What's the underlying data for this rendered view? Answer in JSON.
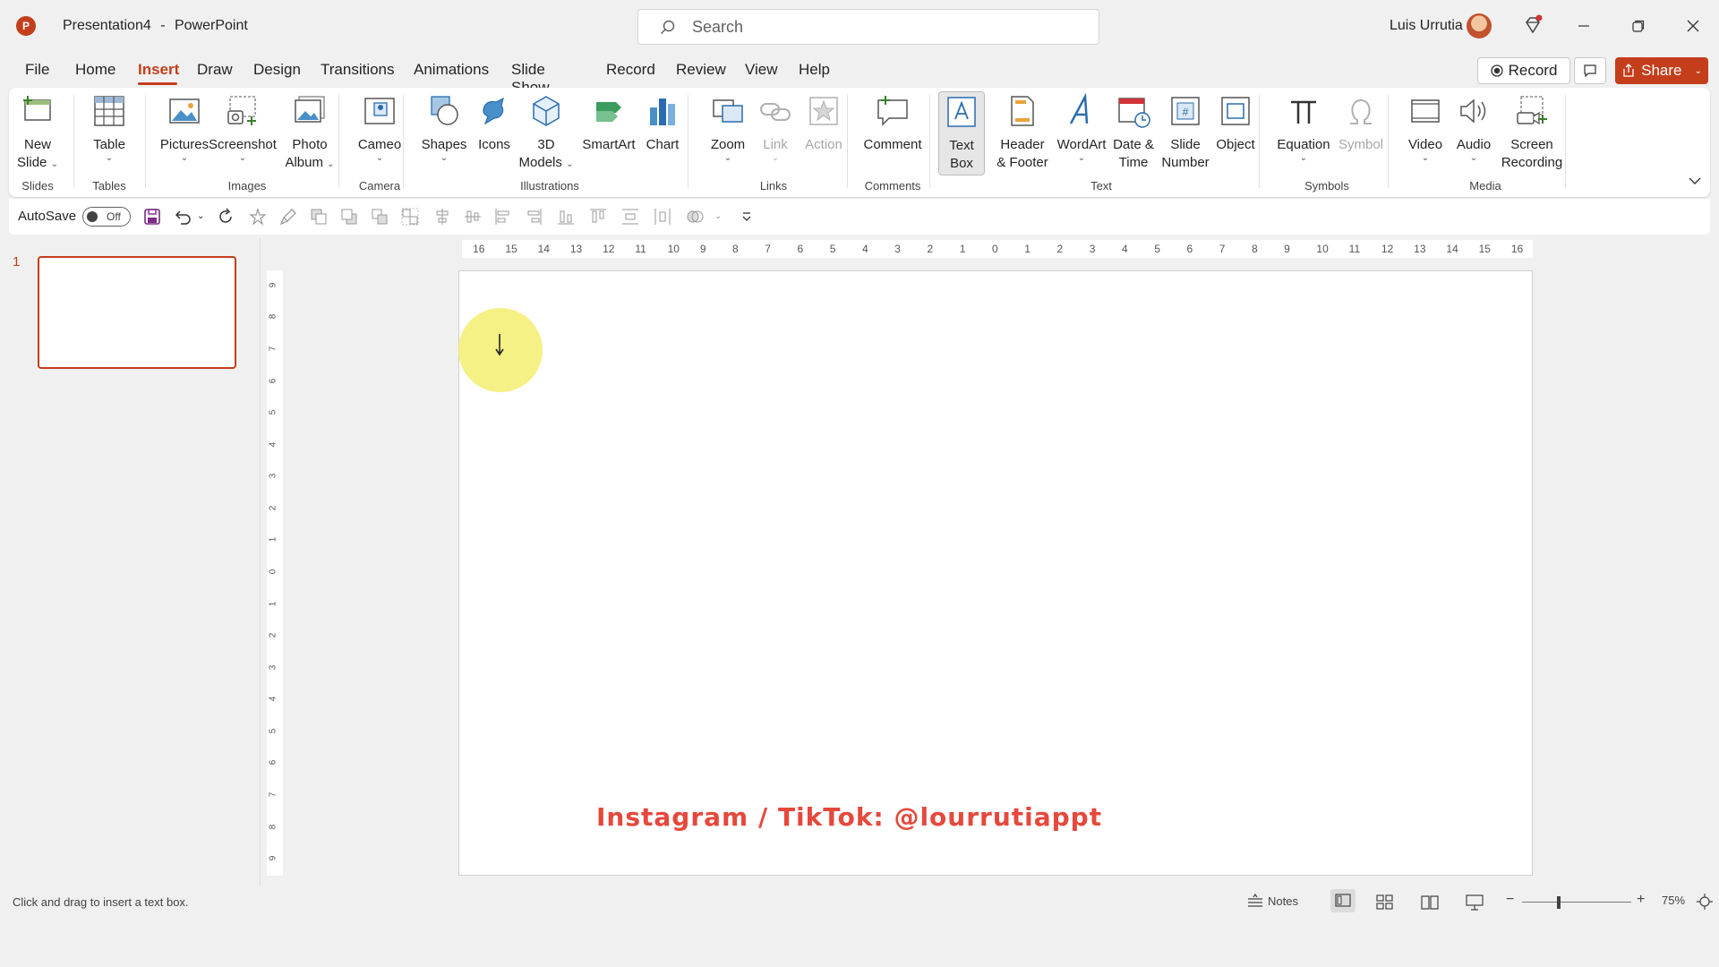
{
  "app": {
    "document_title": "Presentation4",
    "app_name": "PowerPoint",
    "title_separator": "-",
    "icon_letter": "P"
  },
  "search": {
    "placeholder": "Search"
  },
  "user": {
    "name": "Luis Urrutia"
  },
  "tabs": [
    {
      "label": "File"
    },
    {
      "label": "Home"
    },
    {
      "label": "Insert",
      "active": true
    },
    {
      "label": "Draw"
    },
    {
      "label": "Design"
    },
    {
      "label": "Transitions"
    },
    {
      "label": "Animations"
    },
    {
      "label": "Slide Show"
    },
    {
      "label": "Record"
    },
    {
      "label": "Review"
    },
    {
      "label": "View"
    },
    {
      "label": "Help"
    }
  ],
  "header_actions": {
    "record": "Record",
    "share": "Share"
  },
  "ribbon": {
    "groups": {
      "slides": "Slides",
      "tables": "Tables",
      "images": "Images",
      "camera": "Camera",
      "illustrations": "Illustrations",
      "links": "Links",
      "comments": "Comments",
      "text": "Text",
      "symbols": "Symbols",
      "media": "Media"
    },
    "buttons": {
      "new_slide": [
        "New",
        "Slide"
      ],
      "table": "Table",
      "pictures": "Pictures",
      "screenshot": "Screenshot",
      "photo_album": [
        "Photo",
        "Album"
      ],
      "cameo": "Cameo",
      "shapes": "Shapes",
      "icons": "Icons",
      "models_3d": [
        "3D",
        "Models"
      ],
      "smartart": "SmartArt",
      "chart": "Chart",
      "zoom": "Zoom",
      "link": "Link",
      "action": "Action",
      "comment": "Comment",
      "text_box": [
        "Text",
        "Box"
      ],
      "header_footer": [
        "Header",
        "& Footer"
      ],
      "wordart": "WordArt",
      "date_time": [
        "Date &",
        "Time"
      ],
      "slide_number": [
        "Slide",
        "Number"
      ],
      "object": "Object",
      "equation": "Equation",
      "symbol": "Symbol",
      "video": "Video",
      "audio": "Audio",
      "screen_recording": [
        "Screen",
        "Recording"
      ]
    }
  },
  "qat": {
    "autosave_label": "AutoSave",
    "toggle_state": "Off"
  },
  "slides_pane": {
    "slide_number": "1"
  },
  "rulers": {
    "horizontal": [
      "16",
      "15",
      "14",
      "13",
      "12",
      "11",
      "10",
      "9",
      "8",
      "7",
      "6",
      "5",
      "4",
      "3",
      "2",
      "1",
      "0",
      "1",
      "2",
      "3",
      "4",
      "5",
      "6",
      "7",
      "8",
      "9",
      "10",
      "11",
      "12",
      "13",
      "14",
      "15",
      "16"
    ],
    "vertical": [
      "9",
      "8",
      "7",
      "6",
      "5",
      "4",
      "3",
      "2",
      "1",
      "0",
      "1",
      "2",
      "3",
      "4",
      "5",
      "6",
      "7",
      "8",
      "9"
    ]
  },
  "slide": {
    "watermark": "Instagram / TikTok: @lourrutiappt"
  },
  "status": {
    "hint": "Click and drag to insert a text box.",
    "notes": "Notes",
    "zoom_level": "75%",
    "zoom_minus": "−",
    "zoom_plus": "+"
  },
  "colors": {
    "accent": "#c43e1c",
    "watermark": "#e6483c",
    "cursor_highlight": "#f5ee6e"
  }
}
